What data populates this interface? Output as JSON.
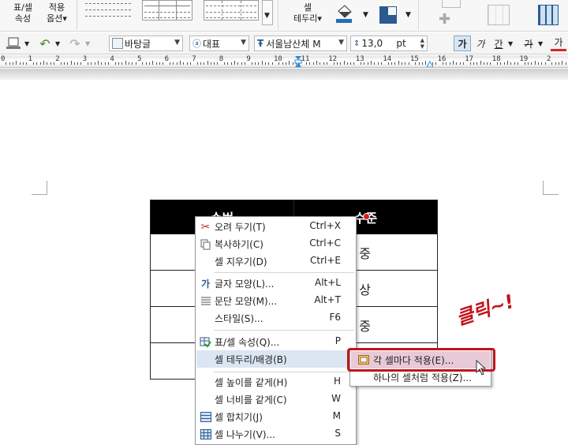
{
  "ribbon": {
    "table_props": "표/셀\n속성",
    "apply_options": "적용\n옵션▾",
    "cell_border": "셀\n테두리▾"
  },
  "toolbar": {
    "para_style": "바탕글",
    "font_type": "대표",
    "font_name": "서울남산체 M",
    "font_size": "13,0",
    "font_unit": "pt",
    "bold_char": "가",
    "italic_char": "가",
    "underline_char": "간",
    "strike_char": "가",
    "color_char": "가"
  },
  "ruler": {
    "numbers": [
      "0",
      "1",
      "2",
      "3",
      "4",
      "5",
      "6",
      "7",
      "8",
      "9",
      "10",
      "11",
      "12",
      "13",
      "14",
      "15",
      "16",
      "17",
      "18",
      "19",
      "2"
    ]
  },
  "table": {
    "headers": [
      "순번",
      "수준"
    ],
    "rows": [
      [
        "",
        "중"
      ],
      [
        "",
        "상"
      ],
      [
        "",
        "중"
      ],
      [
        "",
        ""
      ]
    ]
  },
  "context_menu": [
    {
      "label": "오려 두기(T)",
      "shortcut": "Ctrl+X",
      "icon": "scissors-icon"
    },
    {
      "label": "복사하기(C)",
      "shortcut": "Ctrl+C",
      "icon": "copy-icon"
    },
    {
      "label": "셀 지우기(D)",
      "shortcut": "Ctrl+E",
      "icon": ""
    },
    {
      "label": "글자 모양(L)...",
      "shortcut": "Alt+L",
      "icon": "char-shape-icon"
    },
    {
      "label": "문단 모양(M)...",
      "shortcut": "Alt+T",
      "icon": "para-shape-icon"
    },
    {
      "label": "스타일(S)...",
      "shortcut": "F6",
      "icon": ""
    },
    {
      "label": "표/셀 속성(Q)...",
      "shortcut": "P",
      "icon": "table-props-icon"
    },
    {
      "label": "셀 테두리/배경(B)",
      "shortcut": "",
      "icon": ""
    },
    {
      "label": "셀 높이를 같게(H)",
      "shortcut": "H",
      "icon": ""
    },
    {
      "label": "셀 너비를 같게(C)",
      "shortcut": "W",
      "icon": ""
    },
    {
      "label": "셀 합치기(J)",
      "shortcut": "M",
      "icon": "merge-cells-icon"
    },
    {
      "label": "셀 나누기(V)...",
      "shortcut": "S",
      "icon": "split-cells-icon"
    }
  ],
  "submenu": [
    {
      "label": "각 셀마다 적용(E)..."
    },
    {
      "label": "하나의 셀처럼 적용(Z)..."
    }
  ],
  "annotation": "클릭~!",
  "colors": {
    "highlight": "#dbe6f2",
    "callout": "#c2141d",
    "header_bg": "#000000"
  }
}
